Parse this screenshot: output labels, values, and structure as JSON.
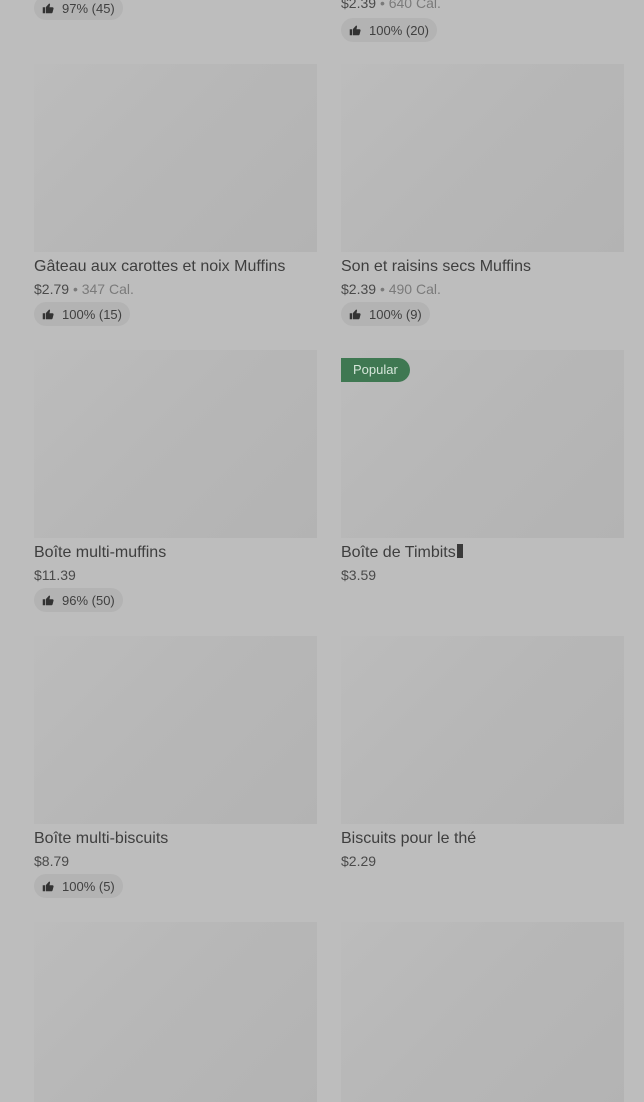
{
  "top_partial": {
    "left": {
      "rating": "97% (45)"
    },
    "right": {
      "price": "$2.39",
      "calories": "640 Cal.",
      "rating": "100% (20)"
    }
  },
  "items": [
    {
      "name": "Gâteau aux carottes et noix Muffins",
      "price": "$2.79",
      "calories": "347 Cal.",
      "rating": "100% (15)"
    },
    {
      "name": "Son et raisins secs Muffins",
      "price": "$2.39",
      "calories": "490 Cal.",
      "rating": "100% (9)"
    },
    {
      "name": "Boîte multi-muffins",
      "price": "$11.39",
      "rating": "96% (50)"
    },
    {
      "name": "Boîte de Timbits",
      "price": "$3.59",
      "badge": "Popular"
    },
    {
      "name": "Boîte multi-biscuits",
      "price": "$8.79",
      "rating": "100% (5)"
    },
    {
      "name": "Biscuits pour le thé",
      "price": "$2.29"
    }
  ],
  "separator": "•",
  "icons": {
    "rating": "thumbs-up-icon"
  },
  "colors": {
    "background": "#bdbdbd",
    "badge": "#3f7852"
  }
}
